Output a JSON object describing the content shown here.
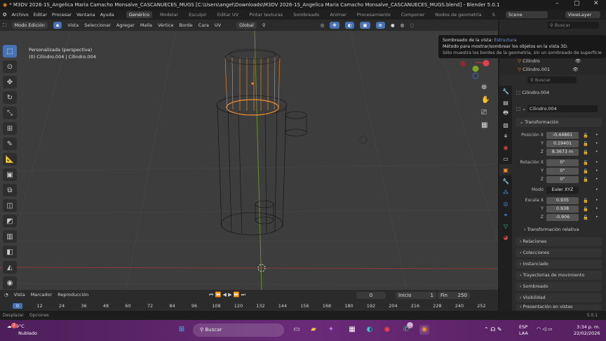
{
  "window": {
    "title": "* M3DV 2026-1S_Angelica Maria Camacho Monsalve_CASCANUECES_MUGS [C:\\Users\\angel\\Downloads\\M3DV 2026-1S_Angelica Maria Camacho Monsalve_CASCANUECES_MUGS.blend] - Blender 5.0.1"
  },
  "menu": [
    "Archivo",
    "Editar",
    "Procesar",
    "Ventana",
    "Ayuda"
  ],
  "workspaces": [
    "Genérico",
    "Modelar",
    "Esculpir",
    "Editar UV",
    "Pintar texturas",
    "Sombreado",
    "Animar",
    "Procesamiento",
    "Componer",
    "Nodos de geometría",
    "S"
  ],
  "active_workspace": "Genérico",
  "scene": "Scene",
  "view_layer": "ViewLayer",
  "header": {
    "mode": "Modo Edición",
    "menus": [
      "Vista",
      "Seleccionar",
      "Agregar",
      "Malla",
      "Vértice",
      "Borde",
      "Cara",
      "UV"
    ],
    "orientation": "Global"
  },
  "viewport": {
    "view_name": "Personalizada (perspectiva)",
    "object_info": "(0) Cilindro.004 | Cilindro.004"
  },
  "tooltip": {
    "title": "Sombreado de la vista:",
    "value": "Estructura",
    "line1": "Método para mostrar/sombrear los objetos en la vista 3D.",
    "line2": "Sólo muestra los bordes de la geometría, sin un sombreado de superficie"
  },
  "outliner": {
    "search_placeholder": "Buscar",
    "items": [
      "Cilindro",
      "Cilindro.001"
    ]
  },
  "properties": {
    "search_placeholder": "Buscar",
    "object_name": "Cilindro.004",
    "name_field": "Cilindro.004",
    "transform": {
      "title": "Transformación",
      "position_label": "Posición X",
      "position": [
        "-0.44861",
        "0.19401",
        "8.3673 m"
      ],
      "rotation_label": "Rotación X",
      "rotation": [
        "0°",
        "0°",
        "0°"
      ],
      "mode_label": "Modo",
      "mode": "Euler XYZ",
      "scale_label": "Escala X",
      "scale": [
        "0.935",
        "0.938",
        "-0.906"
      ],
      "axes": [
        "Y",
        "Z"
      ],
      "relative": "Transformación relativa"
    },
    "panels": [
      "Relaciones",
      "Colecciones",
      "Instanciado",
      "Trayectorias de movimiento",
      "Sombreado",
      "Visibilidad",
      "Presentación en vistas"
    ]
  },
  "timeline": {
    "menus": [
      "Vista",
      "Marcador",
      "Reproducción"
    ],
    "current_frame": "0",
    "start_label": "Inicio",
    "start": "1",
    "end_label": "Fin",
    "end": "250",
    "ticks": [
      "0",
      "12",
      "24",
      "36",
      "48",
      "60",
      "72",
      "84",
      "96",
      "108",
      "120",
      "132",
      "144",
      "156",
      "168",
      "180",
      "192",
      "204",
      "216",
      "228",
      "240",
      "252"
    ]
  },
  "status": {
    "left": [
      "Desplazar",
      "Opciones"
    ],
    "version": "5.0.1"
  },
  "taskbar": {
    "weather_temp": "19°C",
    "weather_desc": "Nublado",
    "weather_badge": "2",
    "search": "Buscar",
    "whatsapp_badge": "11",
    "lang": "ESP",
    "lang2": "LAA",
    "time": "3:34 p. m.",
    "date": "22/02/2026"
  },
  "colors": {
    "accent": "#4772b3",
    "selected": "#f5922f",
    "taskbar": "#5e2569"
  }
}
